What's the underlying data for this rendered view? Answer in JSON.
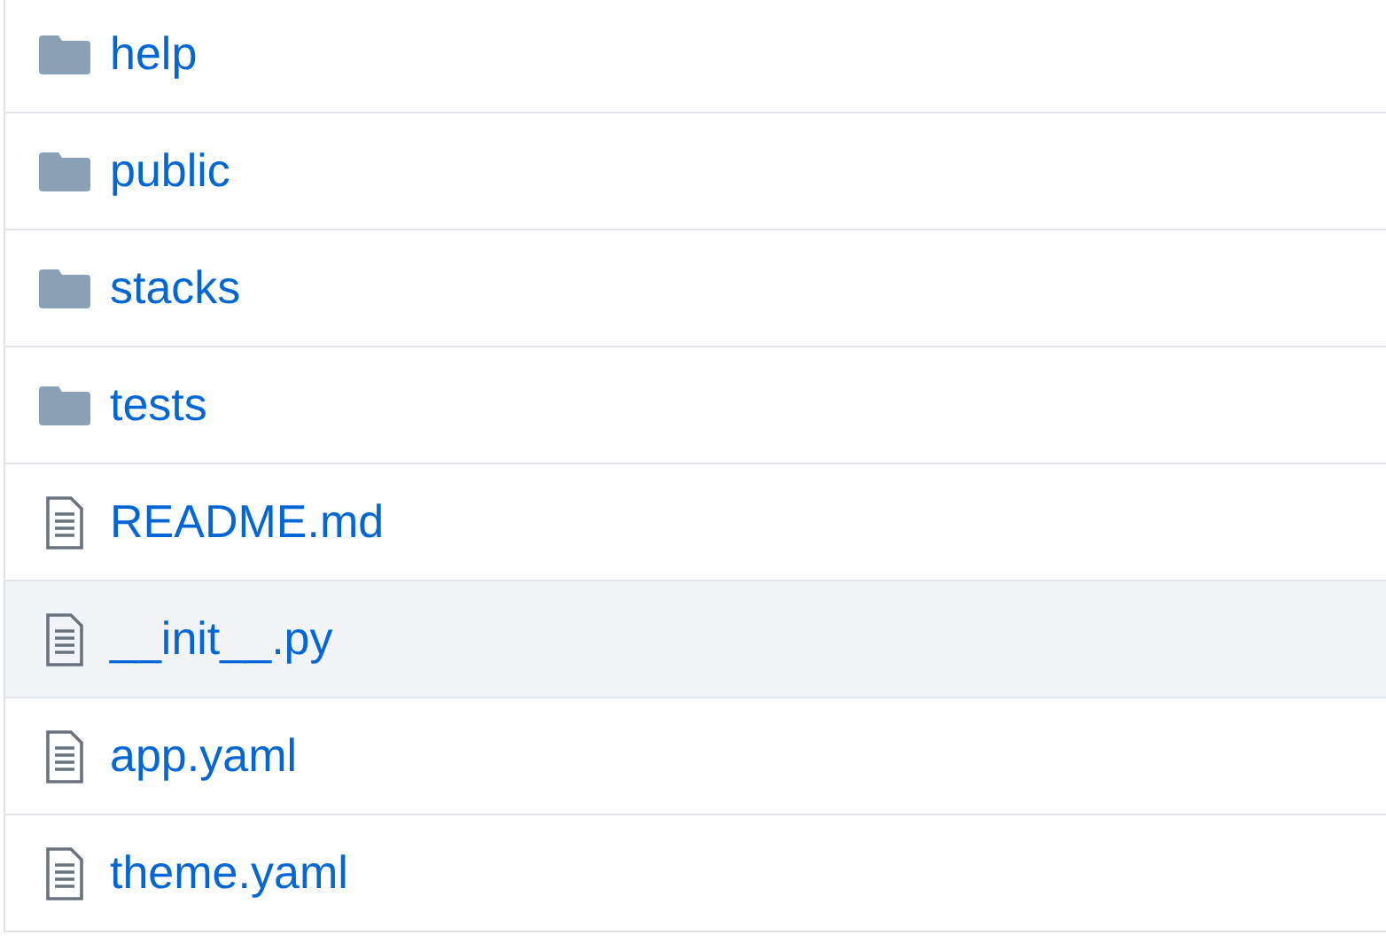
{
  "files": [
    {
      "kind": "folder",
      "name": "help",
      "highlighted": false
    },
    {
      "kind": "folder",
      "name": "public",
      "highlighted": false
    },
    {
      "kind": "folder",
      "name": "stacks",
      "highlighted": false
    },
    {
      "kind": "folder",
      "name": "tests",
      "highlighted": false
    },
    {
      "kind": "file",
      "name": "README.md",
      "highlighted": false
    },
    {
      "kind": "file",
      "name": "__init__.py",
      "highlighted": true
    },
    {
      "kind": "file",
      "name": "app.yaml",
      "highlighted": false
    },
    {
      "kind": "file",
      "name": "theme.yaml",
      "highlighted": false
    }
  ]
}
